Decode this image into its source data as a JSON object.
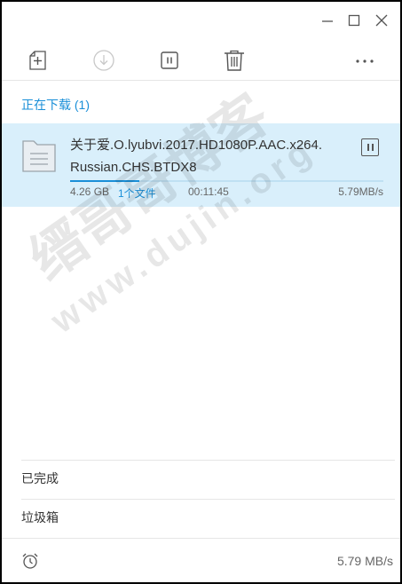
{
  "sections": {
    "active_label": "正在下载 (1)",
    "completed_label": "已完成",
    "trash_label": "垃圾箱"
  },
  "task": {
    "name": "关于爱.O.lyubvi.2017.HD1080P.AAC.x264.Russian.CHS.BTDX8",
    "size": "4.26 GB",
    "files": "1个文件",
    "elapsed": "00:11:45",
    "speed": "5.79MB/s",
    "progress_fraction": 0.22,
    "state": "downloading"
  },
  "footer": {
    "speed": "5.79 MB/s"
  },
  "watermark": {
    "line1": "缙哥哥博客",
    "line2": "www.dujin.org"
  },
  "icons": {
    "new_task": "new-task-icon",
    "start": "download-circle-icon",
    "pause": "pause-icon",
    "delete": "trash-icon",
    "more": "more-dots-icon",
    "file": "folder-document-icon",
    "speed_limit": "alarm-clock-icon"
  },
  "colors": {
    "accent": "#1a8fd8",
    "selected_row": "#d9effb",
    "disabled_icon": "#c8c8c8",
    "icon": "#555555"
  }
}
